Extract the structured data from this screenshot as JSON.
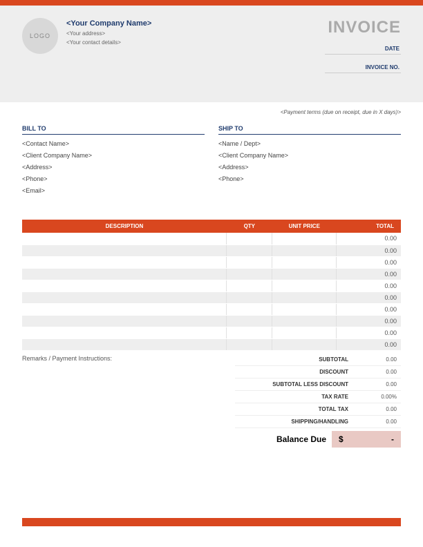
{
  "header": {
    "logo_text": "LOGO",
    "company_name": "<Your Company Name>",
    "address": "<Your address>",
    "contact": "<Your contact details>",
    "invoice_title": "INVOICE",
    "date_label": "DATE",
    "invoice_no_label": "INVOICE NO."
  },
  "payment_terms": "<Payment terms (due on receipt, due in X days)>",
  "bill_to": {
    "header": "BILL TO",
    "lines": [
      "<Contact Name>",
      "<Client Company Name>",
      "<Address>",
      "<Phone>",
      "<Email>"
    ]
  },
  "ship_to": {
    "header": "SHIP TO",
    "lines": [
      "<Name / Dept>",
      "<Client Company Name>",
      "<Address>",
      "<Phone>"
    ]
  },
  "table": {
    "headers": {
      "description": "DESCRIPTION",
      "qty": "QTY",
      "unit_price": "UNIT PRICE",
      "total": "TOTAL"
    },
    "rows": [
      {
        "desc": "",
        "qty": "",
        "price": "",
        "total": "0.00"
      },
      {
        "desc": "",
        "qty": "",
        "price": "",
        "total": "0.00"
      },
      {
        "desc": "",
        "qty": "",
        "price": "",
        "total": "0.00"
      },
      {
        "desc": "",
        "qty": "",
        "price": "",
        "total": "0.00"
      },
      {
        "desc": "",
        "qty": "",
        "price": "",
        "total": "0.00"
      },
      {
        "desc": "",
        "qty": "",
        "price": "",
        "total": "0.00"
      },
      {
        "desc": "",
        "qty": "",
        "price": "",
        "total": "0.00"
      },
      {
        "desc": "",
        "qty": "",
        "price": "",
        "total": "0.00"
      },
      {
        "desc": "",
        "qty": "",
        "price": "",
        "total": "0.00"
      },
      {
        "desc": "",
        "qty": "",
        "price": "",
        "total": "0.00"
      }
    ]
  },
  "remarks_label": "Remarks / Payment Instructions:",
  "totals": {
    "subtotal": {
      "label": "SUBTOTAL",
      "value": "0.00"
    },
    "discount": {
      "label": "DISCOUNT",
      "value": "0.00"
    },
    "subtotal_less": {
      "label": "SUBTOTAL LESS DISCOUNT",
      "value": "0.00"
    },
    "tax_rate": {
      "label": "TAX RATE",
      "value": "0.00%"
    },
    "total_tax": {
      "label": "TOTAL TAX",
      "value": "0.00"
    },
    "shipping": {
      "label": "SHIPPING/HANDLING",
      "value": "0.00"
    }
  },
  "balance": {
    "label": "Balance Due",
    "currency": "$",
    "value": "-"
  }
}
